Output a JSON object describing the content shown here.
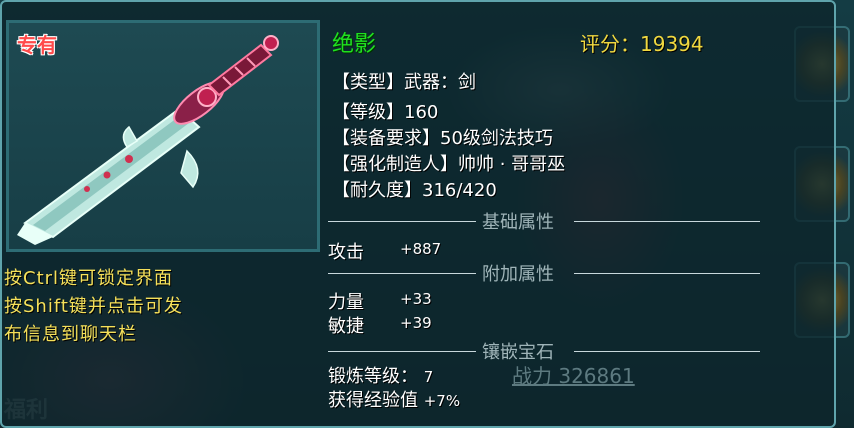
{
  "item": {
    "exclusive_tag": "专有",
    "name": "绝影",
    "score_label": "评分：",
    "score_value": "19394",
    "attributes": [
      {
        "label": "【类型】",
        "value": "武器：剑"
      },
      {
        "label": "【等级】",
        "value": "160"
      },
      {
        "label": "【装备要求】",
        "value": "50级剑法技巧"
      },
      {
        "label": "【强化制造人】",
        "value": "帅帅 · 哥哥巫"
      },
      {
        "label": "【耐久度】",
        "value": "316/420"
      }
    ]
  },
  "hint": {
    "line1": "按Ctrl键可锁定界面",
    "line2": "按Shift键并点击可发",
    "line3": "布信息到聊天栏"
  },
  "sections": {
    "base": {
      "title": "基础属性",
      "stats": [
        {
          "label": "攻击",
          "value": "+887"
        }
      ]
    },
    "extra": {
      "title": "附加属性",
      "stats": [
        {
          "label": "力量",
          "value": "+33"
        },
        {
          "label": "敏捷",
          "value": "+39"
        }
      ]
    },
    "gems": {
      "title": "镶嵌宝石"
    }
  },
  "forge": {
    "label": "锻炼等级：",
    "value": "7"
  },
  "exp_bonus": {
    "label": "获得经验值",
    "value": "+7%"
  },
  "background": {
    "power_text": "战力 326861",
    "fuli_text": "福利"
  },
  "colors": {
    "name_green": "#20e020",
    "score_gold": "#f0d840",
    "exclusive_red": "#ff4a4a",
    "hint_yellow": "#f5e05a"
  },
  "icons": [
    "sword-icon",
    "game-slot-icon"
  ]
}
